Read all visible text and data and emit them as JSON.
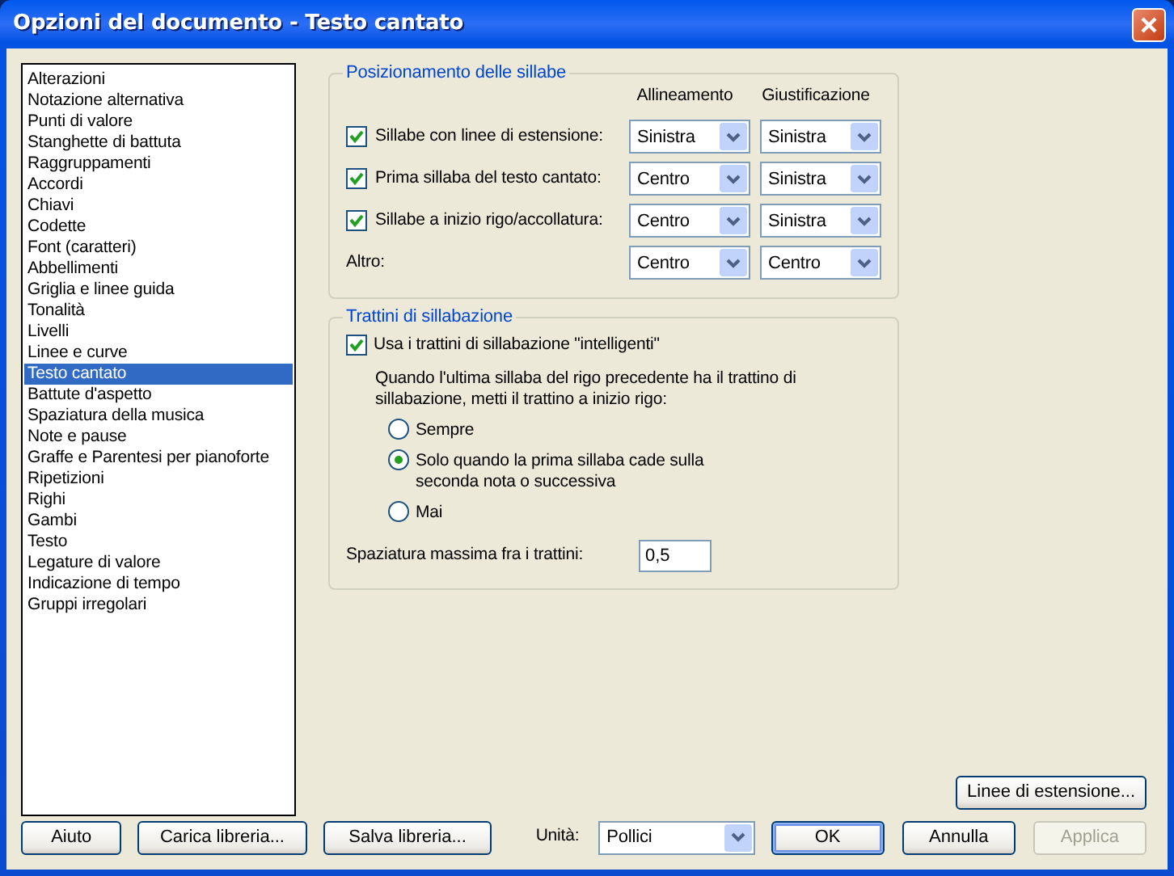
{
  "window": {
    "title": "Opzioni del documento - Testo cantato"
  },
  "categories": [
    {
      "label": "Alterazioni",
      "selected": false
    },
    {
      "label": "Notazione alternativa",
      "selected": false
    },
    {
      "label": "Punti di valore",
      "selected": false
    },
    {
      "label": "Stanghette di battuta",
      "selected": false
    },
    {
      "label": "Raggruppamenti",
      "selected": false
    },
    {
      "label": "Accordi",
      "selected": false
    },
    {
      "label": "Chiavi",
      "selected": false
    },
    {
      "label": "Codette",
      "selected": false
    },
    {
      "label": "Font (caratteri)",
      "selected": false
    },
    {
      "label": "Abbellimenti",
      "selected": false
    },
    {
      "label": "Griglia e linee guida",
      "selected": false
    },
    {
      "label": "Tonalità",
      "selected": false
    },
    {
      "label": "Livelli",
      "selected": false
    },
    {
      "label": "Linee e curve",
      "selected": false
    },
    {
      "label": "Testo cantato",
      "selected": true
    },
    {
      "label": "Battute d'aspetto",
      "selected": false
    },
    {
      "label": "Spaziatura della musica",
      "selected": false
    },
    {
      "label": "Note e pause",
      "selected": false
    },
    {
      "label": "Graffe e Parentesi per pianoforte",
      "selected": false
    },
    {
      "label": "Ripetizioni",
      "selected": false
    },
    {
      "label": "Righi",
      "selected": false
    },
    {
      "label": "Gambi",
      "selected": false
    },
    {
      "label": "Testo",
      "selected": false
    },
    {
      "label": "Legature di valore",
      "selected": false
    },
    {
      "label": "Indicazione di tempo",
      "selected": false
    },
    {
      "label": "Gruppi irregolari",
      "selected": false
    }
  ],
  "syllable_positioning": {
    "title": "Posizionamento delle sillabe",
    "columns": [
      "Allineamento",
      "Giustificazione"
    ],
    "rows": [
      {
        "kind": "checkbox",
        "label": "Sillabe con linee di estensione:",
        "checked": true,
        "alignment": "Sinistra",
        "justification": "Sinistra"
      },
      {
        "kind": "checkbox",
        "label": "Prima sillaba del testo cantato:",
        "checked": true,
        "alignment": "Centro",
        "justification": "Sinistra"
      },
      {
        "kind": "checkbox",
        "label": "Sillabe a inizio rigo/accollatura:",
        "checked": true,
        "alignment": "Centro",
        "justification": "Sinistra"
      },
      {
        "kind": "plain",
        "label": "Altro:",
        "alignment": "Centro",
        "justification": "Centro"
      }
    ]
  },
  "hyphens": {
    "title": "Trattini di sillabazione",
    "smart": {
      "label": "Usa i trattini di sillabazione \"intelligenti\"",
      "checked": true
    },
    "description": "Quando l'ultima sillaba del rigo precedente ha il trattino di\nsillabazione, metti il trattino a inizio rigo:",
    "options": [
      {
        "label": "Sempre",
        "selected": false
      },
      {
        "label": "Solo quando la prima sillaba cade sulla\n seconda nota o successiva",
        "selected": true
      },
      {
        "label": "Mai",
        "selected": false
      }
    ],
    "max_spacing": {
      "label": "Spaziatura massima fra i trattini:",
      "value": "0,5"
    }
  },
  "extension_button": "Linee di estensione...",
  "footer": {
    "left_buttons": [
      {
        "label": "Aiuto",
        "disabled": false,
        "default": false
      },
      {
        "label": "Carica libreria...",
        "disabled": false,
        "default": false
      },
      {
        "label": "Salva libreria...",
        "disabled": false,
        "default": false
      }
    ],
    "units": {
      "label": "Unità:",
      "value": "Pollici"
    },
    "right_buttons": [
      {
        "label": "OK",
        "disabled": false,
        "default": true
      },
      {
        "label": "Annulla",
        "disabled": false,
        "default": false
      },
      {
        "label": "Applica",
        "disabled": true,
        "default": false
      }
    ]
  }
}
